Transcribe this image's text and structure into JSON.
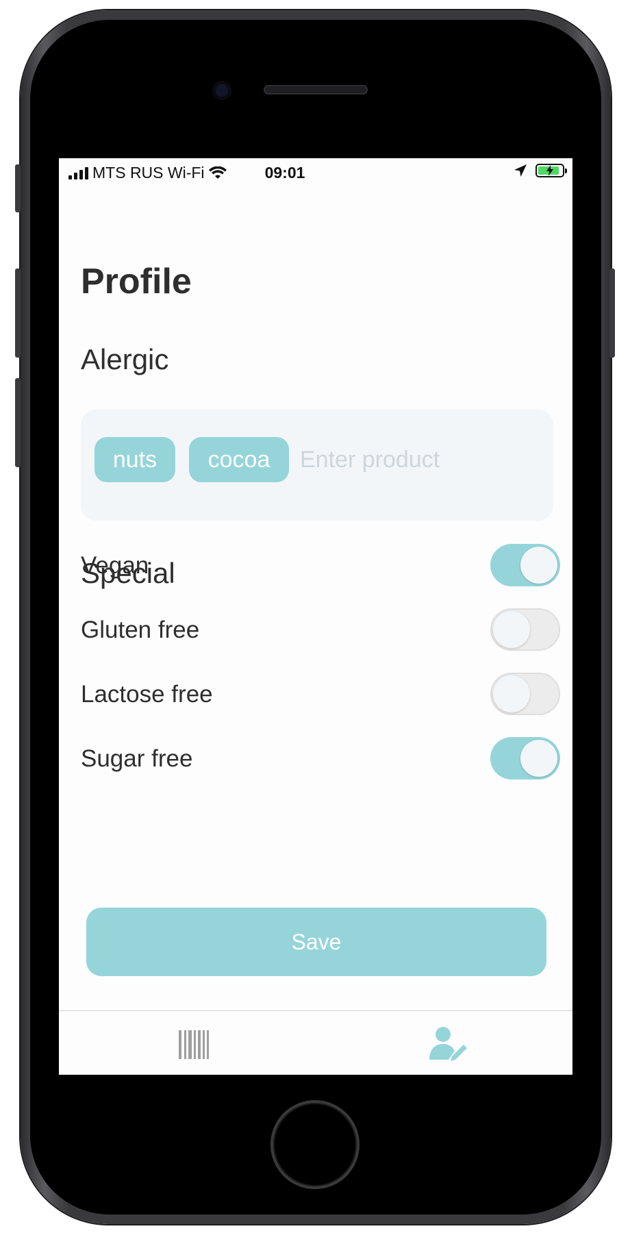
{
  "status_bar": {
    "carrier": "MTS RUS Wi-Fi",
    "time": "09:01"
  },
  "page": {
    "title": "Profile"
  },
  "allergic": {
    "heading": "Alergic",
    "tags": [
      "nuts",
      "cocoa"
    ],
    "input_placeholder": "Enter product"
  },
  "special": {
    "heading": "Special",
    "options": [
      {
        "label": "Vegan",
        "enabled": true
      },
      {
        "label": "Gluten free",
        "enabled": false
      },
      {
        "label": "Lactose free",
        "enabled": false
      },
      {
        "label": "Sugar free",
        "enabled": true
      }
    ]
  },
  "actions": {
    "save_label": "Save"
  },
  "tabbar": {
    "tabs": [
      {
        "icon": "barcode-icon",
        "active": false
      },
      {
        "icon": "profile-edit-icon",
        "active": true
      }
    ]
  },
  "colors": {
    "accent": "#95d5da",
    "inactive_tab": "#9e9e9e",
    "text": "#2e2e2e"
  }
}
